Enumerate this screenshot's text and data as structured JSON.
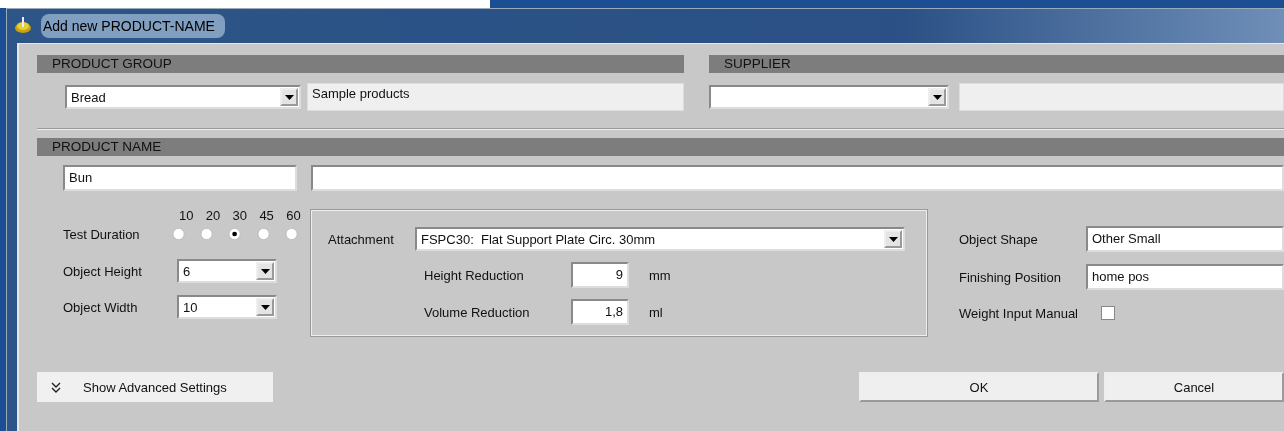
{
  "window": {
    "title": "Add new PRODUCT-NAME"
  },
  "product_group": {
    "header": "PRODUCT GROUP",
    "value": "Bread",
    "description": "Sample products"
  },
  "supplier": {
    "header": "SUPPLIER"
  },
  "product_name": {
    "header": "PRODUCT NAME",
    "short_name": "Bun"
  },
  "test_duration": {
    "label": "Test Duration",
    "options": [
      {
        "label": "10",
        "selected": false
      },
      {
        "label": "20",
        "selected": false
      },
      {
        "label": "30",
        "selected": true
      },
      {
        "label": "45",
        "selected": false
      },
      {
        "label": "60",
        "selected": false
      }
    ]
  },
  "object_height": {
    "label": "Object Height",
    "value": "6"
  },
  "object_width": {
    "label": "Object Width",
    "value": "10"
  },
  "attachment": {
    "label": "Attachment",
    "value": "FSPC30:  Flat Support Plate Circ. 30mm",
    "height_reduction": {
      "label": "Height Reduction",
      "value": "9",
      "unit": "mm"
    },
    "volume_reduction": {
      "label": "Volume Reduction",
      "value": "1,8",
      "unit": "ml"
    }
  },
  "object_shape": {
    "label": "Object Shape",
    "value": "Other Small"
  },
  "finishing_position": {
    "label": "Finishing Position",
    "value": "home pos"
  },
  "weight_input_manual": {
    "label": "Weight Input Manual",
    "checked": false
  },
  "advanced": {
    "label": "Show Advanced Settings"
  },
  "buttons": [
    {
      "label": "OK"
    },
    {
      "label": "Cancel"
    }
  ]
}
